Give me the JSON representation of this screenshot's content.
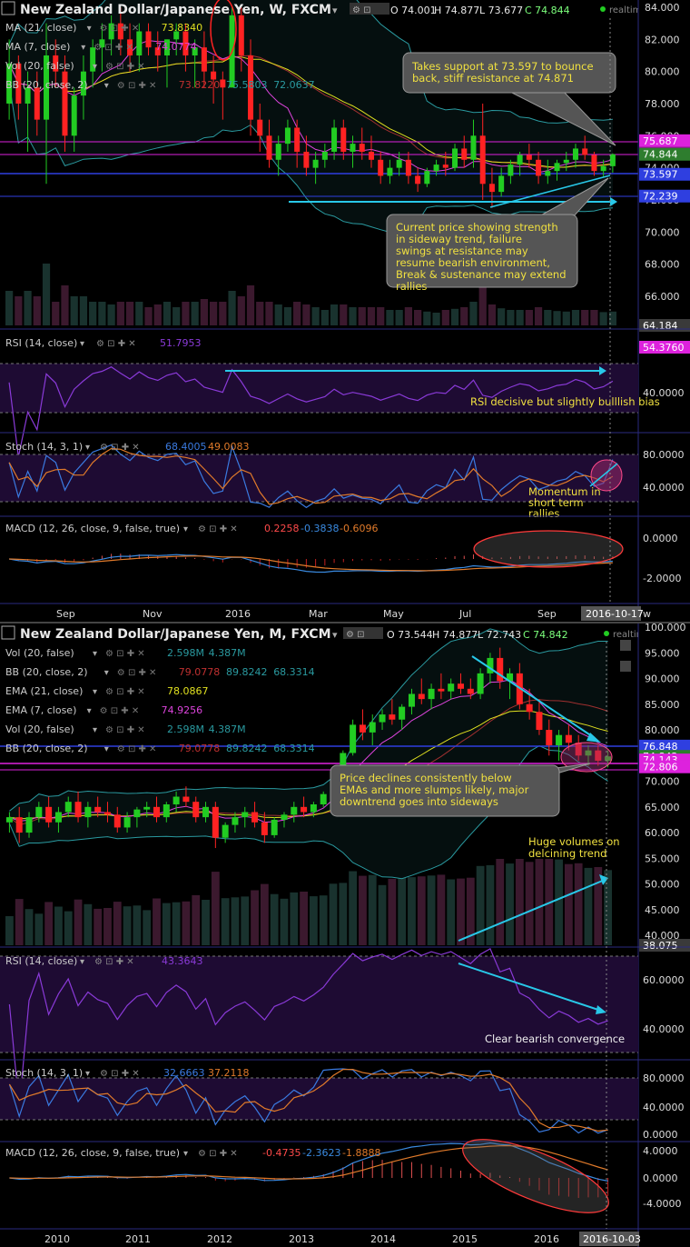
{
  "colors": {
    "bg": "#000000",
    "up": "#22cc22",
    "down": "#ff2222",
    "ma21": "#e0e020",
    "ma7": "#dd44dd",
    "bb": "#2a9aa0",
    "ema21": "#e0e020",
    "ema7": "#dd44dd",
    "rsi": "#8a3ad8",
    "stochK": "#3a7ae0",
    "stochD": "#e07a2a",
    "macdLine": "#3a8ae0",
    "macdSignal": "#e07a2a",
    "annotation": "#28c8e8",
    "callout_text": "#f0e040",
    "price_tag": "#dd22dd"
  },
  "weekly": {
    "header": {
      "title": "New Zealand Dollar/Japanese Yen, W, FXCM",
      "o": "O 74.001",
      "h": "H 74.877",
      "l": "L 73.677",
      "c": "C 74.844",
      "realtime": "realtime"
    },
    "legend": [
      {
        "label": "MA (21, close)",
        "value": "73.8340",
        "value2": "",
        "value3": "",
        "color": "#e0e020"
      },
      {
        "label": "MA (7, close)",
        "value": "74.0774",
        "value2": "",
        "value3": "",
        "color": "#dd44dd"
      },
      {
        "label": "Vol (20, false)",
        "value": "",
        "value2": "",
        "value3": "",
        "color": "#2a9aa0"
      },
      {
        "label": "BB (20, close, 2)",
        "value": "73.8220",
        "value2": "75.5803",
        "value3": "72.0637",
        "color": "#c03030"
      }
    ],
    "price_axis": [
      "84.000",
      "82.000",
      "80.000",
      "78.000",
      "76.000",
      "74.000",
      "72.000",
      "70.000",
      "68.000",
      "66.000"
    ],
    "price_tags": [
      {
        "text": "75.687",
        "color": "#dd22dd"
      },
      {
        "text": "74.871",
        "color": "#dd22dd"
      },
      {
        "text": "74.844",
        "color": "#2e7d2e"
      },
      {
        "text": "73.597",
        "color": "#2f3fe0"
      },
      {
        "text": "72.239",
        "color": "#2f3fe0"
      },
      {
        "text": "64.184",
        "color": "#3a3a3a"
      }
    ],
    "callouts": [
      "Takes support at 73.597 to bounce back, stiff resistance at 74.871",
      "Current price showing strength in sideway trend, failure swings at resistance may resume bearish environment, Break & sustenance may extend rallies"
    ],
    "rsi": {
      "label": "RSI (14, close)",
      "value": "51.7953",
      "tag": "54.3760",
      "axis": [
        "40.0000"
      ],
      "note": "RSI decisive but slightly bulllish bias"
    },
    "stoch": {
      "label": "Stoch (14, 3, 1)",
      "k": "68.4005",
      "d": "49.0083",
      "axis": [
        "80.0000",
        "40.0000"
      ],
      "note": "Momentum in short term rallies"
    },
    "macd": {
      "label": "MACD (12, 26, close, 9, false, true)",
      "v1": "0.2258",
      "v2": "-0.3838",
      "v3": "-0.6096",
      "axis": [
        "0.0000",
        "-2.0000"
      ]
    },
    "time_axis": [
      "Sep",
      "Nov",
      "2016",
      "Mar",
      "May",
      "Jul",
      "Sep"
    ],
    "date_tag": "2016-10-17",
    "time_tail": "w"
  },
  "monthly": {
    "header": {
      "title": "New Zealand Dollar/Japanese Yen, M, FXCM",
      "o": "O 73.544",
      "h": "H 74.877",
      "l": "L 72.743",
      "c": "C 74.842",
      "realtime": "realtime"
    },
    "legend": [
      {
        "label": "Vol (20, false)",
        "value": "2.598M",
        "value2": "4.387M",
        "value3": "",
        "color": "#2a9aa0"
      },
      {
        "label": "BB (20, close, 2)",
        "value": "79.0778",
        "value2": "89.8242",
        "value3": "68.3314",
        "color": "#c03030"
      },
      {
        "label": "EMA (21, close)",
        "value": "78.0867",
        "value2": "",
        "value3": "",
        "color": "#e0e020"
      },
      {
        "label": "EMA (7, close)",
        "value": "74.9256",
        "value2": "",
        "value3": "",
        "color": "#dd44dd"
      },
      {
        "label": "Vol (20, false)",
        "value": "2.598M",
        "value2": "4.387M",
        "value3": "",
        "color": "#2a9aa0"
      },
      {
        "label": "BB (20, close, 2)",
        "value": "79.0778",
        "value2": "89.8242",
        "value3": "68.3314",
        "color": "#c03030"
      }
    ],
    "price_axis": [
      "100.000",
      "95.000",
      "90.000",
      "85.000",
      "80.000",
      "75.000",
      "70.000",
      "65.000",
      "60.000",
      "55.000",
      "50.000",
      "45.000",
      "40.000"
    ],
    "price_tags": [
      {
        "text": "76.848",
        "color": "#2f3fe0"
      },
      {
        "text": "74.842",
        "color": "#2e7d2e"
      },
      {
        "text": "74.143",
        "color": "#dd22dd"
      },
      {
        "text": "72.806",
        "color": "#dd22dd"
      },
      {
        "text": "38.075",
        "color": "#3a3a3a"
      }
    ],
    "callouts": [
      "Price declines consistently below EMAs and more slumps likely, major downtrend goes into sideways"
    ],
    "volume_note": "Huge volumes on delcining trend",
    "rsi": {
      "label": "RSI (14, close)",
      "value": "43.3643",
      "axis": [
        "60.0000",
        "40.0000"
      ],
      "note": "Clear bearish convergence"
    },
    "stoch": {
      "label": "Stoch (14, 3, 1)",
      "k": "32.6663",
      "d": "37.2118",
      "axis": [
        "80.0000",
        "40.0000",
        "0.0000"
      ]
    },
    "macd": {
      "label": "MACD (12, 26, close, 9, false, true)",
      "v1": "-0.4735",
      "v2": "-2.3623",
      "v3": "-1.8888",
      "axis": [
        "4.0000",
        "0.0000",
        "-4.0000"
      ]
    },
    "time_axis": [
      "2010",
      "2011",
      "2012",
      "2013",
      "2014",
      "2015",
      "2016"
    ],
    "date_tag": "2016-10-03"
  },
  "chart_data": [
    {
      "type": "candlestick",
      "title": "New Zealand Dollar/Japanese Yen, W, FXCM",
      "timeframe": "W",
      "ylim": [
        64.184,
        84.0
      ],
      "x_labels": [
        "Sep",
        "Nov",
        "2016",
        "Mar",
        "May",
        "Jul",
        "Sep"
      ],
      "ohlc": [
        [
          78,
          82,
          77,
          80.5
        ],
        [
          80.5,
          81,
          77,
          78
        ],
        [
          78,
          80,
          75,
          79
        ],
        [
          79,
          80,
          76,
          77
        ],
        [
          77,
          83,
          73,
          81
        ],
        [
          81,
          82,
          79,
          80
        ],
        [
          80,
          81,
          75,
          76
        ],
        [
          76,
          79,
          75,
          78.5
        ],
        [
          78.5,
          81,
          77,
          80
        ],
        [
          80,
          82,
          79,
          81.5
        ],
        [
          81.5,
          83,
          80,
          82
        ],
        [
          82,
          83.5,
          81,
          83
        ],
        [
          83,
          84,
          81,
          82
        ],
        [
          82,
          83,
          80,
          81
        ],
        [
          81,
          83,
          80,
          82.5
        ],
        [
          82.5,
          83,
          81,
          81.5
        ],
        [
          81.5,
          82.5,
          80,
          81
        ],
        [
          81,
          82,
          79,
          82
        ],
        [
          82,
          83,
          81,
          82.5
        ],
        [
          82.5,
          83,
          80,
          81
        ],
        [
          81,
          82,
          79,
          81.5
        ],
        [
          81.5,
          82.5,
          79,
          80
        ],
        [
          80,
          81,
          78,
          79.5
        ],
        [
          79.5,
          80,
          77,
          79
        ],
        [
          79,
          84,
          79,
          83.5
        ],
        [
          83.5,
          84,
          80,
          81
        ],
        [
          81,
          82,
          76,
          77
        ],
        [
          77,
          78,
          75,
          76
        ],
        [
          76,
          77,
          74,
          74.5
        ],
        [
          74.5,
          76,
          73.5,
          75.5
        ],
        [
          75.5,
          77,
          75,
          76.5
        ],
        [
          76.5,
          77,
          74,
          75
        ],
        [
          75,
          76,
          73.5,
          74
        ],
        [
          74,
          75,
          73,
          74.5
        ],
        [
          74.5,
          75.5,
          74,
          75
        ],
        [
          75,
          77,
          74.5,
          76.5
        ],
        [
          76.5,
          77,
          74.5,
          75
        ],
        [
          75,
          76,
          74,
          75.5
        ],
        [
          75.5,
          76.5,
          74.5,
          75
        ],
        [
          75,
          76,
          74,
          74.5
        ],
        [
          74.5,
          75,
          73,
          73.5
        ],
        [
          73.5,
          74.5,
          73,
          74
        ],
        [
          74,
          75,
          73.5,
          74.5
        ],
        [
          74.5,
          75,
          73,
          73.5
        ],
        [
          73.5,
          74,
          72.5,
          73
        ],
        [
          73,
          74,
          72.8,
          73.8
        ],
        [
          73.8,
          74.5,
          73.5,
          74.2
        ],
        [
          74.2,
          75,
          73.5,
          74
        ],
        [
          74,
          75.5,
          73.8,
          75.2
        ],
        [
          75.2,
          76,
          74,
          74.5
        ],
        [
          74.5,
          77,
          74,
          76
        ],
        [
          76,
          78,
          72,
          73
        ],
        [
          73,
          74,
          71.5,
          72.5
        ],
        [
          72.5,
          74,
          72.2,
          73.5
        ],
        [
          73.5,
          74.5,
          73,
          74.2
        ],
        [
          74.2,
          75,
          73.5,
          74.8
        ],
        [
          74.8,
          75.5,
          74,
          74.5
        ],
        [
          74.5,
          75,
          73,
          73.5
        ],
        [
          73.5,
          74.5,
          73,
          73.8
        ],
        [
          73.8,
          74.5,
          73.2,
          74.3
        ],
        [
          74.3,
          75,
          73.8,
          74.5
        ],
        [
          74.5,
          75.5,
          74,
          75.2
        ],
        [
          75.2,
          76,
          74.5,
          74.8
        ],
        [
          74.8,
          75,
          73.5,
          73.8
        ],
        [
          73.8,
          74.5,
          73.4,
          74.1
        ],
        [
          74.1,
          74.9,
          73.7,
          74.84
        ]
      ],
      "series": [
        {
          "name": "MA (21, close)",
          "last": 73.834
        },
        {
          "name": "MA (7, close)",
          "last": 74.0774
        },
        {
          "name": "BB (20, close, 2)",
          "basis": 73.822,
          "upper": 75.5803,
          "lower": 72.0637
        }
      ],
      "levels": [
        75.687,
        74.871,
        74.844,
        73.597,
        72.239
      ],
      "indicators": {
        "rsi": 51.7953,
        "stoch_k": 68.4005,
        "stoch_d": 49.0083,
        "macd": [
          0.2258,
          -0.3838,
          -0.6096
        ]
      }
    },
    {
      "type": "candlestick",
      "title": "New Zealand Dollar/Japanese Yen, M, FXCM",
      "timeframe": "M",
      "ylim": [
        38.075,
        100.0
      ],
      "x_labels": [
        "2010",
        "2011",
        "2012",
        "2013",
        "2014",
        "2015",
        "2016"
      ],
      "ohlc": [
        [
          62,
          64,
          60,
          63
        ],
        [
          63,
          65,
          58,
          60
        ],
        [
          60,
          64,
          59,
          63
        ],
        [
          63,
          66,
          62,
          65
        ],
        [
          65,
          67,
          61,
          62
        ],
        [
          62,
          65,
          60,
          64
        ],
        [
          64,
          67,
          63,
          66
        ],
        [
          66,
          68,
          62,
          63
        ],
        [
          63,
          66,
          61,
          65
        ],
        [
          65,
          67,
          63,
          64
        ],
        [
          64,
          66,
          62,
          63.5
        ],
        [
          63.5,
          65,
          60,
          61
        ],
        [
          61,
          64,
          60,
          63
        ],
        [
          63,
          65,
          61,
          64.5
        ],
        [
          64.5,
          66,
          63,
          65
        ],
        [
          65,
          67,
          62,
          63
        ],
        [
          63,
          66,
          62,
          65.5
        ],
        [
          65.5,
          68,
          64,
          67
        ],
        [
          67,
          69,
          65,
          66
        ],
        [
          66,
          67,
          62,
          63
        ],
        [
          63,
          66,
          62,
          65
        ],
        [
          65,
          66,
          57,
          59
        ],
        [
          59,
          62,
          58,
          61.5
        ],
        [
          61.5,
          64,
          60,
          63
        ],
        [
          63,
          65,
          61,
          64
        ],
        [
          64,
          66,
          61,
          62
        ],
        [
          62,
          64,
          58,
          59.5
        ],
        [
          59.5,
          63,
          59,
          62.5
        ],
        [
          62.5,
          64,
          61,
          63.5
        ],
        [
          63.5,
          66,
          62,
          65
        ],
        [
          65,
          67,
          63,
          64
        ],
        [
          64,
          66,
          63,
          65.5
        ],
        [
          65.5,
          68,
          65,
          67.5
        ],
        [
          67.5,
          72,
          67,
          71.5
        ],
        [
          71.5,
          76,
          71,
          75.5
        ],
        [
          75.5,
          82,
          75,
          81
        ],
        [
          81,
          84,
          78,
          79.5
        ],
        [
          79.5,
          83,
          77,
          81.5
        ],
        [
          81.5,
          84,
          80,
          83
        ],
        [
          83,
          86,
          81,
          82
        ],
        [
          82,
          85,
          80,
          84.5
        ],
        [
          84.5,
          88,
          83,
          87
        ],
        [
          87,
          90,
          85,
          86
        ],
        [
          86,
          89,
          84,
          88
        ],
        [
          88,
          91,
          86,
          87.5
        ],
        [
          87.5,
          90,
          86,
          89
        ],
        [
          89,
          91,
          87,
          88
        ],
        [
          88,
          90,
          86,
          87
        ],
        [
          87,
          92,
          86,
          91
        ],
        [
          91,
          95,
          89,
          94
        ],
        [
          94,
          96,
          88,
          89.5
        ],
        [
          89.5,
          92,
          86,
          91
        ],
        [
          91,
          93,
          84,
          85
        ],
        [
          85,
          88,
          82,
          83.5
        ],
        [
          83.5,
          86,
          79,
          80
        ],
        [
          80,
          82,
          75,
          77
        ],
        [
          77,
          80,
          74,
          79
        ],
        [
          79,
          81,
          76,
          77.5
        ],
        [
          77.5,
          79,
          74,
          75
        ],
        [
          75,
          77,
          73,
          76
        ],
        [
          76,
          77,
          73,
          74
        ],
        [
          74,
          76,
          72.7,
          74.84
        ]
      ],
      "series": [
        {
          "name": "EMA (21, close)",
          "last": 78.0867
        },
        {
          "name": "EMA (7, close)",
          "last": 74.9256
        },
        {
          "name": "BB (20, close, 2)",
          "basis": 79.0778,
          "upper": 89.8242,
          "lower": 68.3314
        },
        {
          "name": "Vol (20, false)",
          "last": "2.598M",
          "avg": "4.387M"
        }
      ],
      "levels": [
        76.848,
        74.842,
        74.143,
        72.806
      ],
      "indicators": {
        "rsi": 43.3643,
        "stoch_k": 32.6663,
        "stoch_d": 37.2118,
        "macd": [
          -0.4735,
          -2.3623,
          -1.8888
        ]
      }
    }
  ]
}
